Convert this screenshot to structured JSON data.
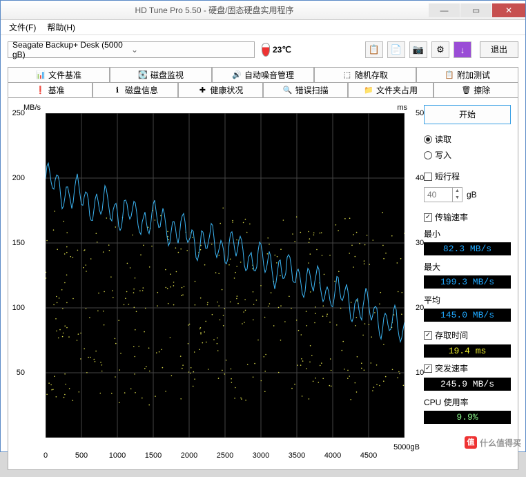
{
  "window": {
    "title": "HD Tune Pro 5.50 - 硬盘/固态硬盘实用程序"
  },
  "menu": {
    "file": "文件(F)",
    "help": "帮助(H)"
  },
  "toolbar": {
    "drive": "Seagate Backup+  Desk (5000 gB)",
    "temperature": "23℃",
    "exit": "退出"
  },
  "tabs_row1": [
    {
      "label": "文件基准",
      "icon": "📊"
    },
    {
      "label": "磁盘监视",
      "icon": "💽"
    },
    {
      "label": "自动噪音管理",
      "icon": "🔊"
    },
    {
      "label": "随机存取",
      "icon": "⬚"
    },
    {
      "label": "附加测试",
      "icon": "📋"
    }
  ],
  "tabs_row2": [
    {
      "label": "基准",
      "icon": "❗",
      "active": true
    },
    {
      "label": "磁盘信息",
      "icon": "ℹ"
    },
    {
      "label": "健康状况",
      "icon": "✚"
    },
    {
      "label": "错误扫描",
      "icon": "🔍"
    },
    {
      "label": "文件夹占用",
      "icon": "📁"
    },
    {
      "label": "擦除",
      "icon": "🗑"
    }
  ],
  "panel": {
    "start": "开始",
    "read": "读取",
    "write": "写入",
    "short_stroke": "短行程",
    "short_value": "40",
    "short_unit": "gB",
    "transfer_rate": "传输速率",
    "min_label": "最小",
    "min_value": "82.3 MB/s",
    "max_label": "最大",
    "max_value": "199.3 MB/s",
    "avg_label": "平均",
    "avg_value": "145.0 MB/s",
    "access_time": "存取时间",
    "access_value": "19.4 ms",
    "burst_rate": "突发速率",
    "burst_value": "245.9 MB/s",
    "cpu_label": "CPU 使用率",
    "cpu_value": "9.9%"
  },
  "watermark": "值 什么值得买",
  "chart_data": {
    "type": "line+scatter",
    "title": "",
    "xlabel": "gB",
    "ylabel_left": "MB/s",
    "ylabel_right": "ms",
    "xlim": [
      0,
      5000
    ],
    "ylim_left": [
      0,
      250
    ],
    "ylim_right": [
      0,
      50
    ],
    "xticks": [
      0,
      500,
      1000,
      1500,
      2000,
      2500,
      3000,
      3500,
      4000,
      4500,
      5000
    ],
    "yticks_left": [
      0,
      50,
      100,
      150,
      200,
      250
    ],
    "yticks_right": [
      0,
      10,
      20,
      30,
      40,
      50
    ],
    "series": [
      {
        "name": "Transfer Rate (MB/s)",
        "axis": "left",
        "style": "line",
        "color": "#3cb6f5",
        "x": [
          0,
          250,
          500,
          750,
          1000,
          1250,
          1500,
          1750,
          2000,
          2250,
          2500,
          2750,
          3000,
          3250,
          3500,
          3750,
          4000,
          4250,
          4500,
          4750,
          5000
        ],
        "values": [
          199,
          190,
          185,
          180,
          175,
          170,
          168,
          162,
          155,
          150,
          148,
          142,
          135,
          130,
          125,
          118,
          112,
          105,
          98,
          90,
          82
        ]
      },
      {
        "name": "Access Time (ms)",
        "axis": "right",
        "style": "scatter",
        "color": "#d6d64a",
        "note": "random scatter of ~400 points ranging roughly 6–38 ms across full x-range, mean ≈19.4 ms"
      }
    ]
  }
}
